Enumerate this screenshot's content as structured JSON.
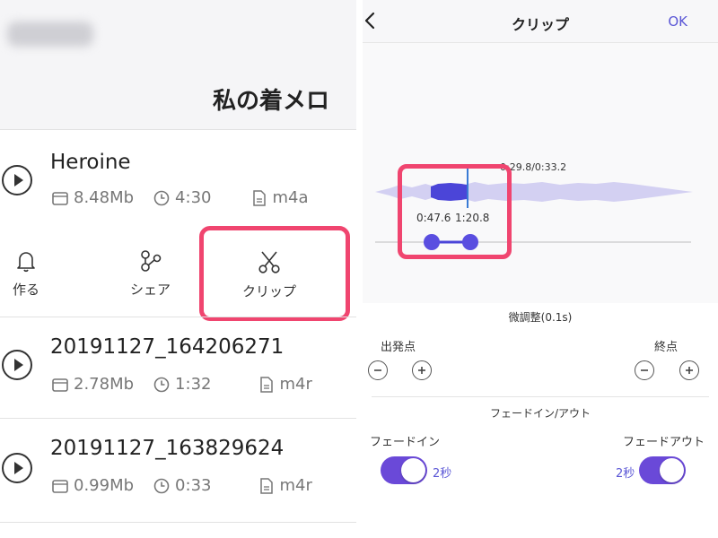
{
  "left_panel": {
    "header": {
      "title": "私の着メロ"
    },
    "tracks": [
      {
        "name": "Heroine",
        "size": "8.48Mb",
        "duration": "4:30",
        "format": "m4a"
      },
      {
        "name": "20191127_164206271",
        "size": "2.78Mb",
        "duration": "1:32",
        "format": "m4r"
      },
      {
        "name": "20191127_163829624",
        "size": "0.99Mb",
        "duration": "0:33",
        "format": "m4r"
      }
    ],
    "actions": {
      "create": {
        "label": "作る",
        "icon": "bell-icon"
      },
      "share": {
        "label": "シェア",
        "icon": "share-icon"
      },
      "clip": {
        "label": "クリップ",
        "icon": "scissors-icon"
      }
    }
  },
  "right_panel": {
    "nav": {
      "title": "クリップ",
      "ok_label": "OK",
      "back_icon": "chevron-left-icon"
    },
    "waveform": {
      "time_readout": "0:29.8/0:33.2",
      "start_time": "0:47.6",
      "end_time": "1:20.8"
    },
    "fine_adjust_label": "微調整(0.1s)",
    "start_point_label": "出発点",
    "end_point_label": "終点",
    "fade_section_title": "フェードイン/アウト",
    "fade_in": {
      "label": "フェードイン",
      "value": "2秒",
      "on": true
    },
    "fade_out": {
      "label": "フェードアウト",
      "value": "2秒",
      "on": true
    }
  },
  "colors": {
    "accent": "#5b57d6",
    "toggle_on": "#6a49d8",
    "highlight": "#f0456f",
    "waveform_light": "#d3d0f2",
    "waveform_selected": "#4b45d8",
    "playhead": "#3a7bd5"
  }
}
